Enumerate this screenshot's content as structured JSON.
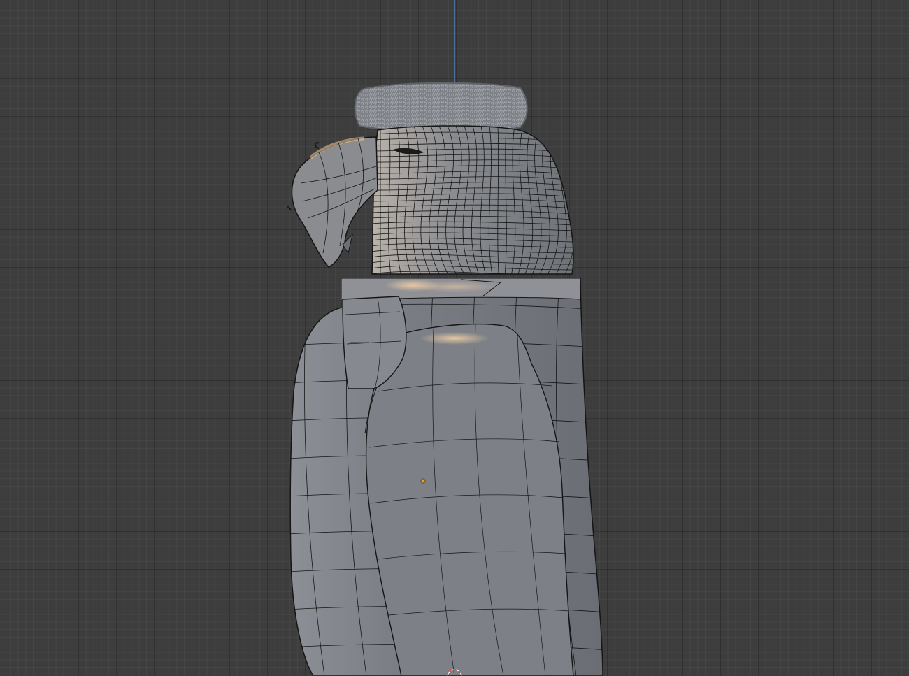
{
  "viewport": {
    "background": "#3d3d3d",
    "grid_minor": "#454545",
    "grid_major": "#2f2f2f"
  },
  "model": {
    "body_color": "#7b7f85",
    "highlight_color": "#f0c89a",
    "wire_color": "#101010",
    "fur_color": "#8a8d92"
  },
  "icons": {
    "origin": "origin-point-icon",
    "cursor": "3d-cursor-icon",
    "axis": "z-axis-line-icon"
  },
  "colors": {
    "origin_point": "#f5a020",
    "axis_line": "#5b8ed6",
    "cursor_ring": "#ff3b3b"
  }
}
